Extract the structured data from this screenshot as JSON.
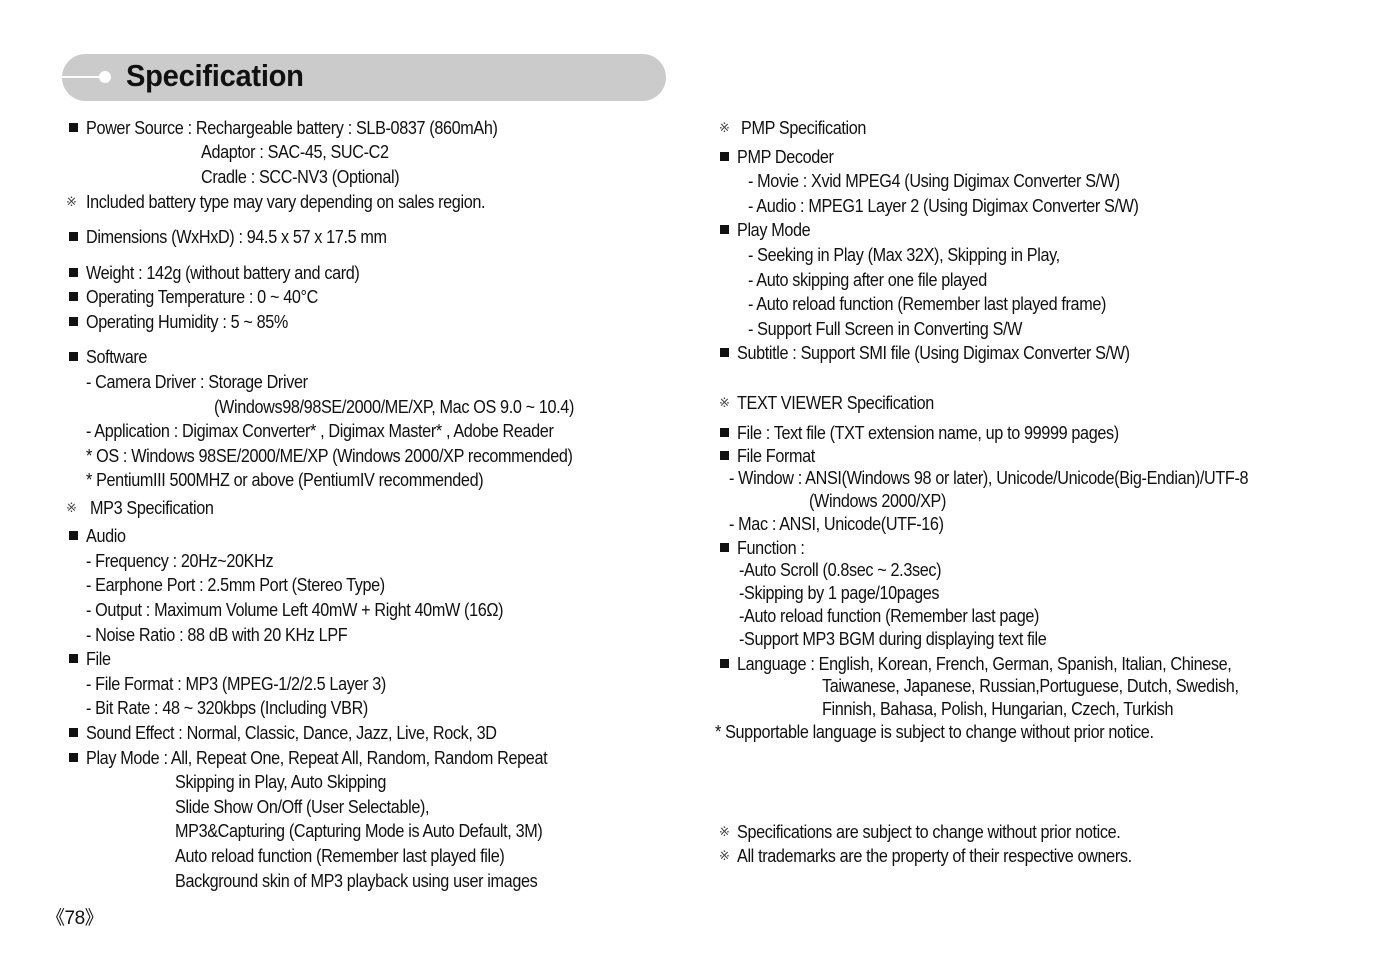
{
  "header": {
    "title": "Specification"
  },
  "left": {
    "power_source": "Power Source : Rechargeable battery : SLB-0837 (860mAh)",
    "adaptor": "Adaptor : SAC-45, SUC-C2",
    "cradle": "Cradle : SCC-NV3 (Optional)",
    "battery_note": "Included battery type may vary depending on sales region.",
    "dimensions": "Dimensions (WxHxD) : 94.5 x 57 x 17.5 mm",
    "weight": "Weight : 142g (without battery and card)",
    "temperature": "Operating Temperature : 0 ~ 40°C",
    "humidity": "Operating Humidity : 5 ~ 85%",
    "software": "Software",
    "camera_driver": "- Camera Driver : Storage Driver",
    "camera_driver_os": "(Windows98/98SE/2000/ME/XP, Mac OS 9.0 ~ 10.4)",
    "application": "- Application : Digimax Converter* , Digimax Master* , Adobe Reader",
    "os_note": "* OS : Windows 98SE/2000/ME/XP (Windows 2000/XP recommended)",
    "cpu_note": "* PentiumIII 500MHZ or above (PentiumIV recommended)",
    "mp3_spec": "MP3 Specification",
    "audio": "Audio",
    "frequency": "- Frequency : 20Hz~20KHz",
    "earphone": "- Earphone Port : 2.5mm Port (Stereo Type)",
    "output": "- Output : Maximum Volume  Left 40mW + Right 40mW (16Ω)",
    "noise": "- Noise Ratio : 88 dB with 20 KHz LPF",
    "file": "File",
    "file_format": "- File Format : MP3 (MPEG-1/2/2.5 Layer 3)",
    "bit_rate": "- Bit Rate : 48 ~ 320kbps (Including VBR)",
    "sound_effect": "Sound Effect : Normal, Classic, Dance, Jazz, Live, Rock, 3D",
    "play_mode": "Play Mode : All, Repeat One, Repeat All, Random, Random Repeat",
    "play_mode_lines": [
      "Skipping in Play, Auto Skipping",
      "Slide Show On/Off (User Selectable),",
      "MP3&Capturing (Capturing Mode is Auto Default, 3M)",
      "Auto reload function (Remember last played file)",
      "Background skin of MP3 playback using user images"
    ]
  },
  "right": {
    "pmp_spec": "PMP Specification",
    "pmp_decoder": "PMP Decoder",
    "movie": "- Movie : Xvid MPEG4 (Using Digimax Converter S/W)",
    "audio": "- Audio : MPEG1 Layer 2 (Using Digimax Converter S/W)",
    "play_mode": "Play Mode",
    "play_mode_lines": [
      "- Seeking in Play (Max 32X), Skipping in Play,",
      "- Auto skipping after one file played",
      "- Auto reload function (Remember last played frame)",
      "- Support Full Screen in Converting S/W"
    ],
    "subtitle": "Subtitle : Support SMI file (Using Digimax Converter S/W)",
    "text_viewer_spec": "TEXT VIEWER Specification",
    "file": "File : Text file (TXT extension name, up to 99999 pages)",
    "file_format": "File Format",
    "window": "- Window : ANSI(Windows 98 or later), Unicode/Unicode(Big-Endian)/UTF-8",
    "window_cont": "(Windows 2000/XP)",
    "mac": "- Mac : ANSI, Unicode(UTF-16)",
    "function": "Function :",
    "function_lines": [
      "-Auto Scroll (0.8sec ~ 2.3sec)",
      "-Skipping by 1 page/10pages",
      "-Auto reload function (Remember last page)",
      "-Support MP3 BGM during displaying text file"
    ],
    "language": "Language : English, Korean, French, German, Spanish, Italian, Chinese,",
    "language_lines": [
      "Taiwanese, Japanese, Russian,Portuguese, Dutch, Swedish,",
      "Finnish, Bahasa, Polish, Hungarian, Czech, Turkish"
    ],
    "language_note": "* Supportable language is subject to change without prior notice.",
    "spec_note": "Specifications are subject to change without prior notice.",
    "trademark_note": "All trademarks are the property of their respective owners."
  },
  "symbols": {
    "reference_mark": "※"
  },
  "footer": {
    "page_number": "《78》"
  }
}
